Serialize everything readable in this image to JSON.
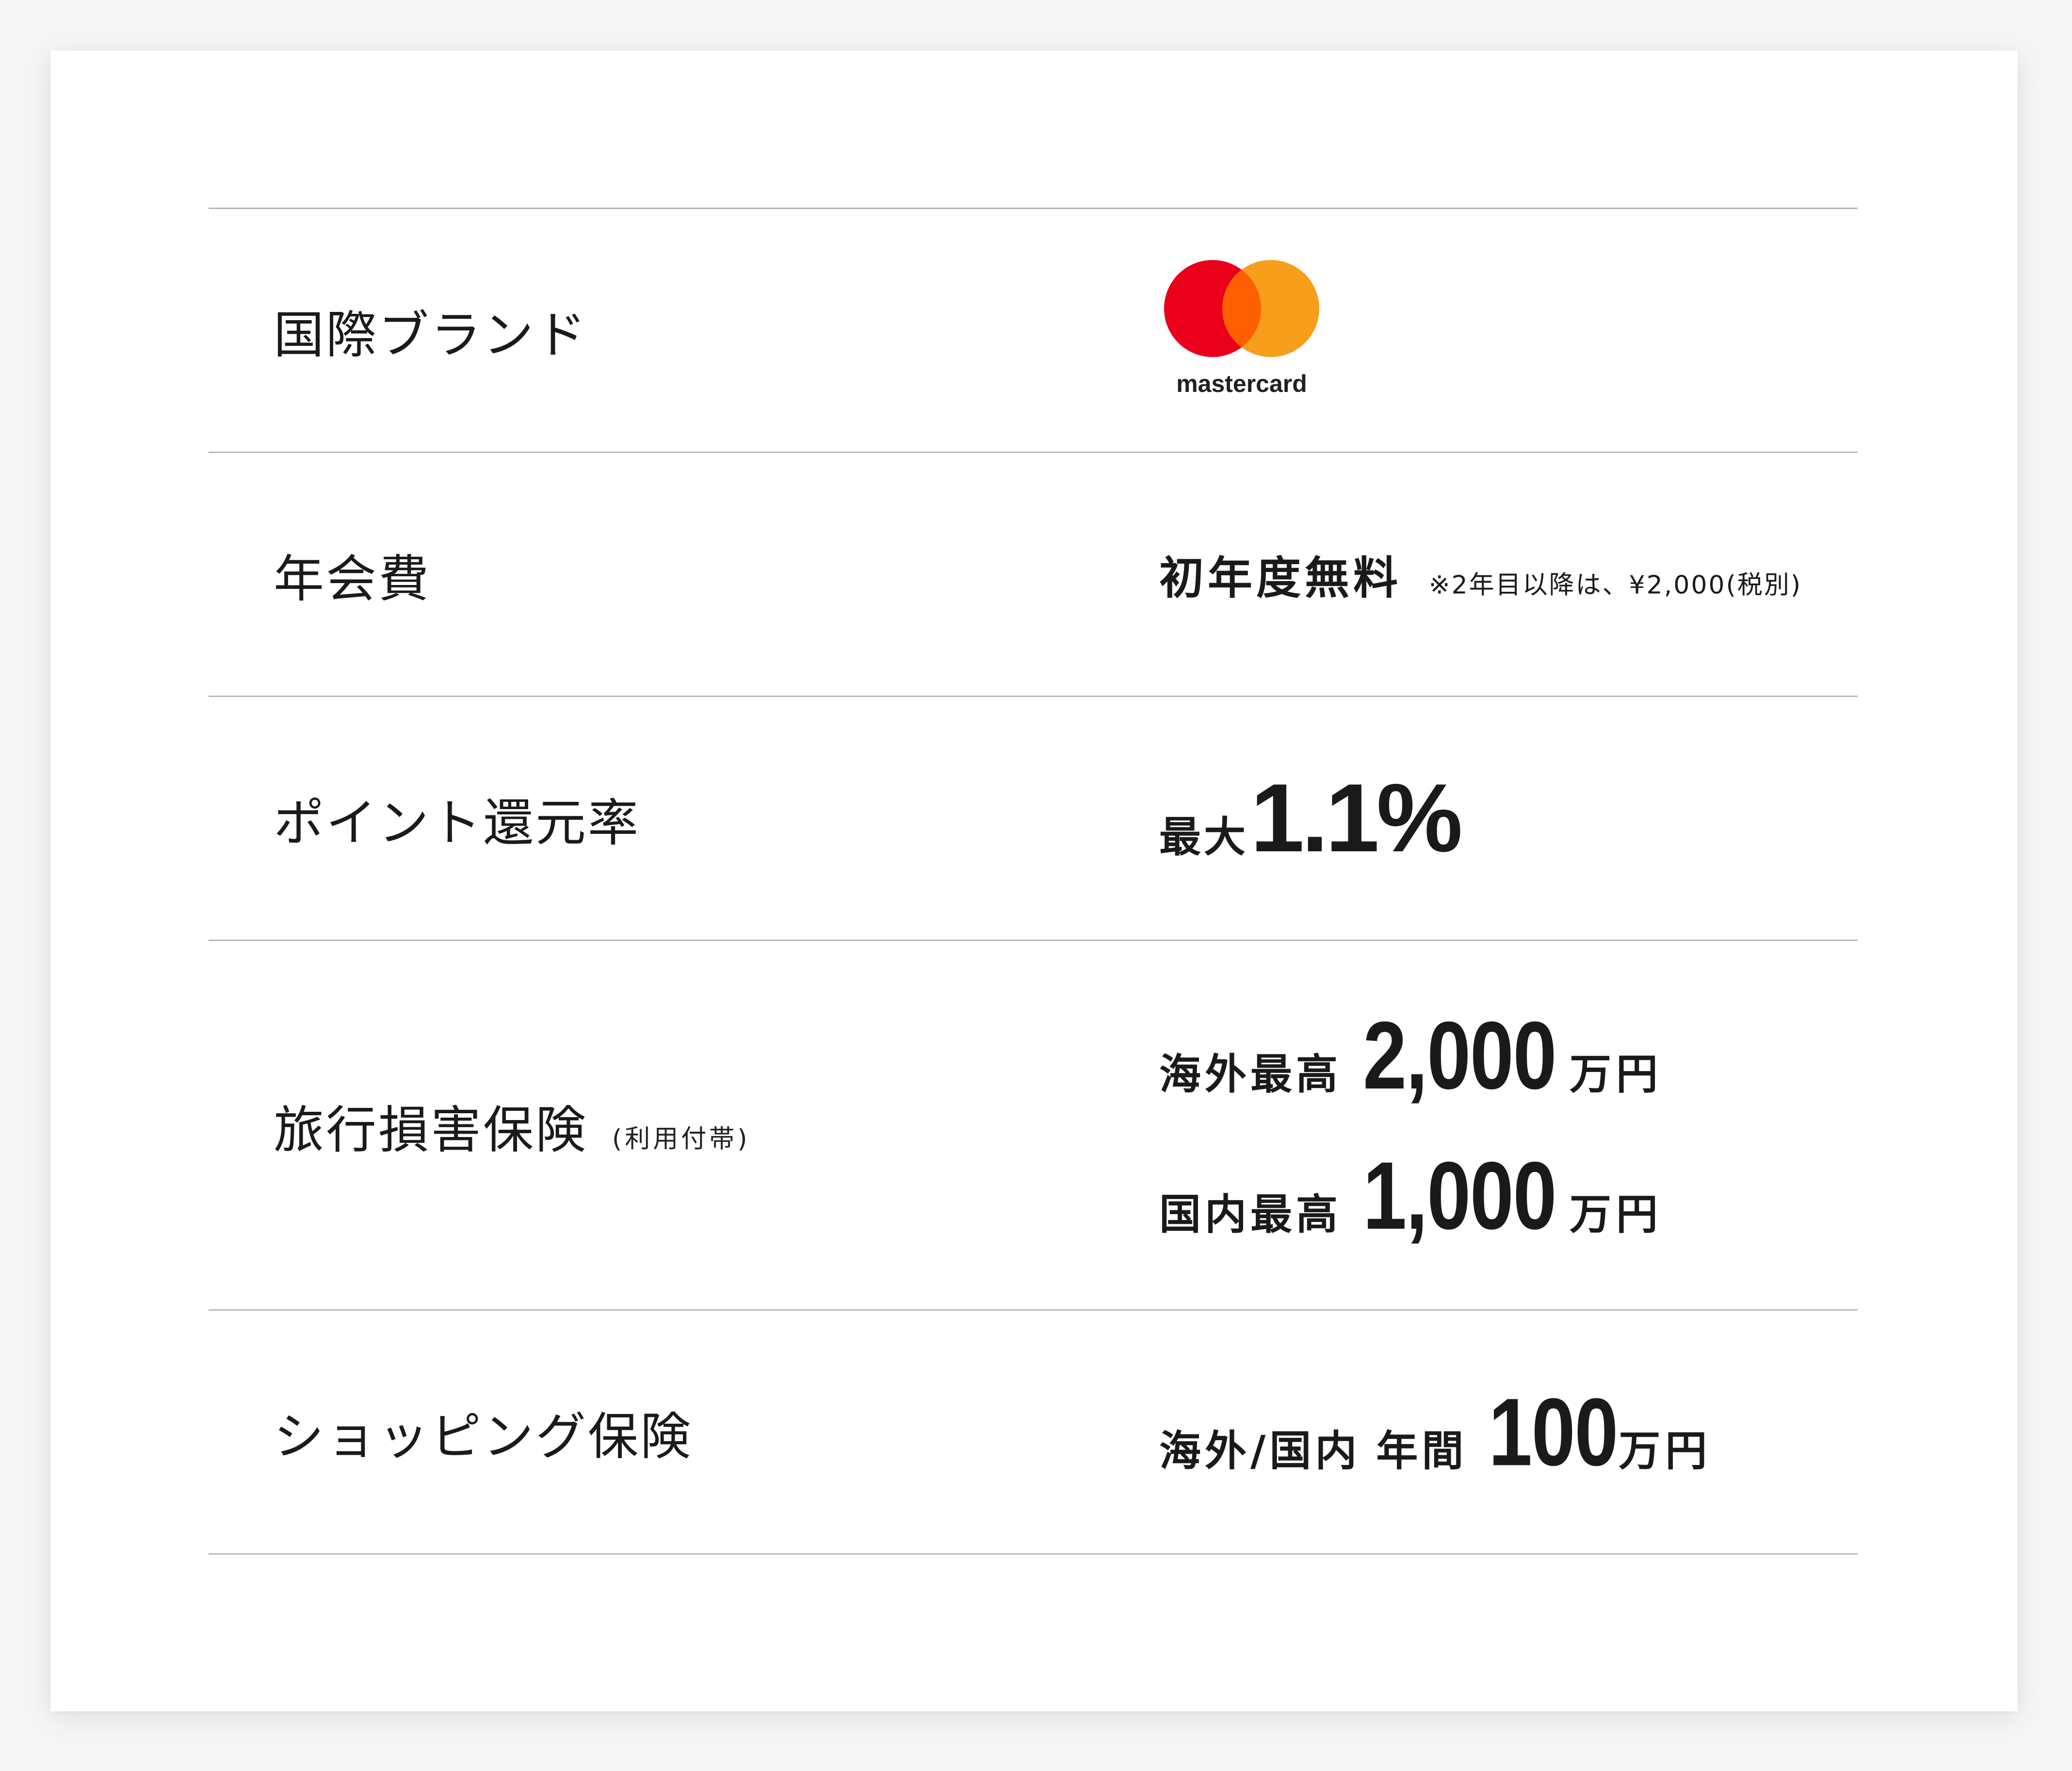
{
  "rows": {
    "brand": {
      "label": "国際ブランド",
      "logo_text": "mastercard",
      "logo_colors": {
        "red": "#eb001b",
        "orange": "#f79e1b",
        "overlap": "#ff5f00"
      }
    },
    "fee": {
      "label": "年会費",
      "value": "初年度無料",
      "note": "※2年目以降は、¥2,000(税別)"
    },
    "point": {
      "label": "ポイント還元率",
      "prefix": "最大",
      "value": "1.1%"
    },
    "travel": {
      "label": "旅行損害保険",
      "label_note": "(利用付帯)",
      "overseas_prefix": "海外最高",
      "overseas_amount": "2,000",
      "domestic_prefix": "国内最高",
      "domestic_amount": "1,000",
      "unit": "万円"
    },
    "shopping": {
      "label": "ショッピング保険",
      "prefix_a": "海外/国内",
      "prefix_b": "年間",
      "amount": "100",
      "unit": "万円"
    }
  }
}
